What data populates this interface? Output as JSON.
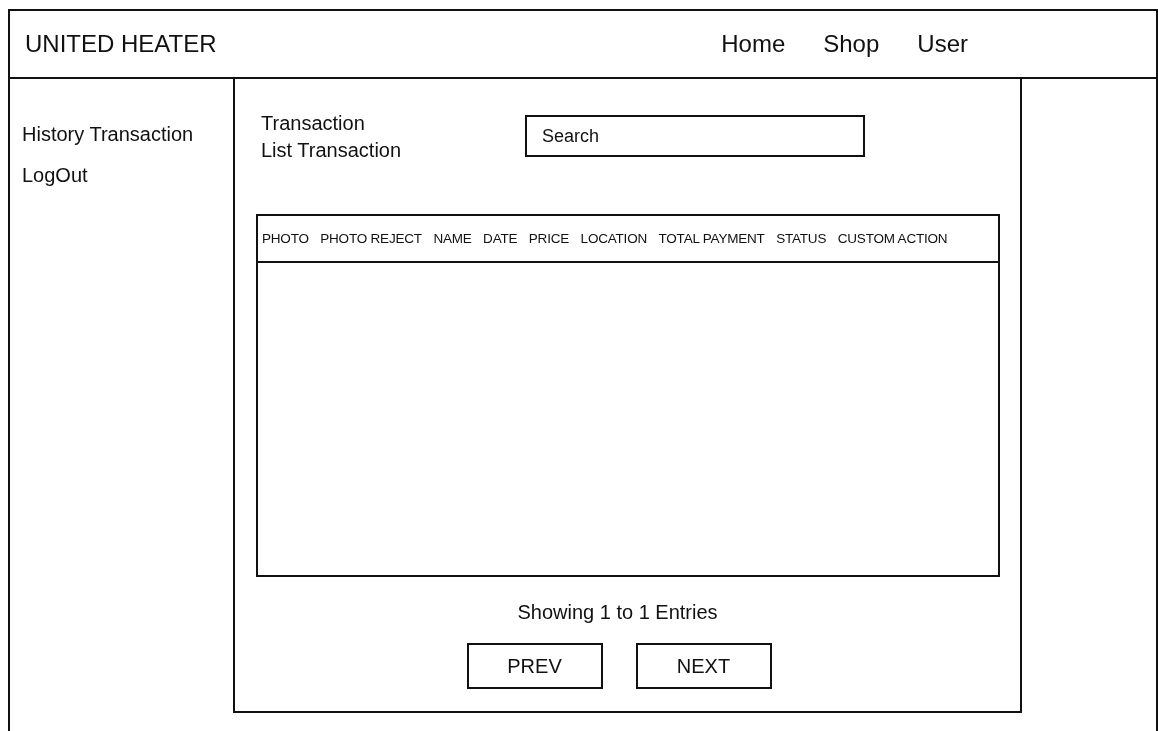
{
  "header": {
    "brand": "UNITED HEATER",
    "nav": [
      {
        "label": "Home"
      },
      {
        "label": "Shop"
      },
      {
        "label": "User"
      }
    ]
  },
  "sidebar": {
    "items": [
      {
        "label": "History Transaction"
      },
      {
        "label": "LogOut"
      }
    ]
  },
  "content": {
    "title": "Transaction",
    "subtitle": "List Transaction",
    "search": {
      "placeholder": "Search"
    },
    "table": {
      "columns": [
        "PHOTO",
        "PHOTO REJECT",
        "NAME",
        "DATE",
        "PRICE",
        "LOCATION",
        "TOTAL PAYMENT",
        "STATUS",
        "CUSTOM ACTION"
      ]
    },
    "footer": "Showing 1 to 1 Entries",
    "buttons": [
      {
        "label": "PREV"
      },
      {
        "label": "NEXT"
      }
    ]
  }
}
